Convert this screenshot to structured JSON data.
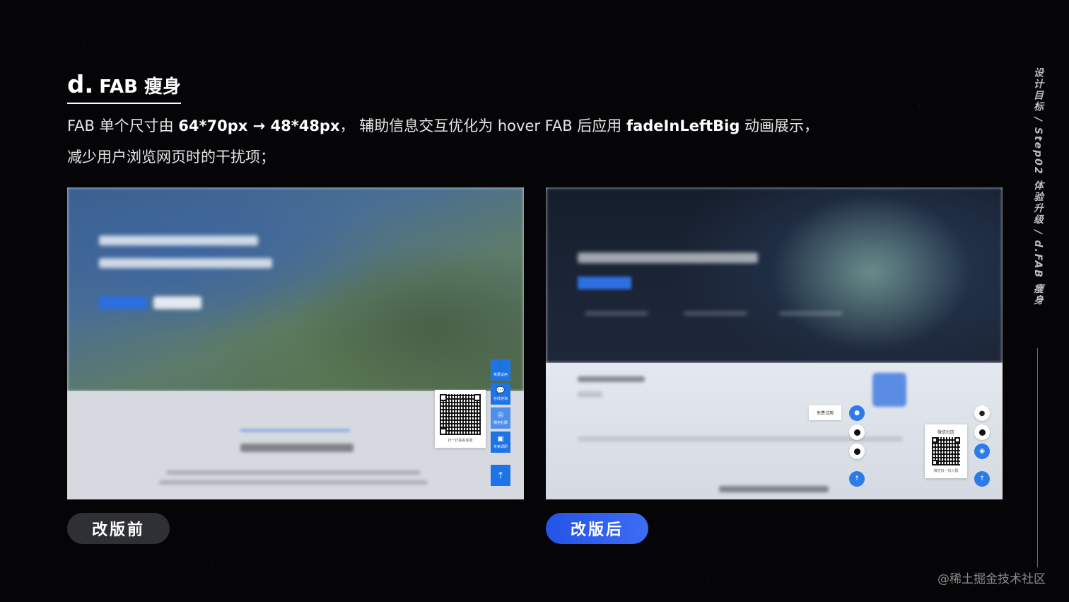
{
  "section": {
    "title_letter": "d.",
    "title_rest": "FAB 瘦身",
    "desc_line1_a": "FAB 单个尺寸由 ",
    "desc_line1_b": "64*70px → 48*48px",
    "desc_line1_c": "， 辅助信息交互优化为 hover FAB 后应用 ",
    "desc_line1_d": "fadeInLeftBig",
    "desc_line1_e": " 动画展示，",
    "desc_line2": "减少用户浏览网页时的干扰项；"
  },
  "before": {
    "label": "改版前",
    "fab_labels": [
      "免费试用",
      "在线咨询",
      "微信社群",
      "专家调研"
    ],
    "qr_caption": "扫一扫联系客服",
    "top_icon": "arrow-up-icon"
  },
  "after": {
    "label": "改版后",
    "hover_tip": "免费试用",
    "qr_title": "微信社区",
    "qr_caption": "微信扫一扫入群"
  },
  "sidebar": {
    "vertical_label": "设计目标 / Step02 体验升级 / d.FAB 瘦身"
  },
  "watermark": "@稀土掘金技术社区",
  "colors": {
    "accent_blue": "#2c7be8",
    "tag_after": "#2454e6",
    "tag_before": "#2f3035"
  }
}
